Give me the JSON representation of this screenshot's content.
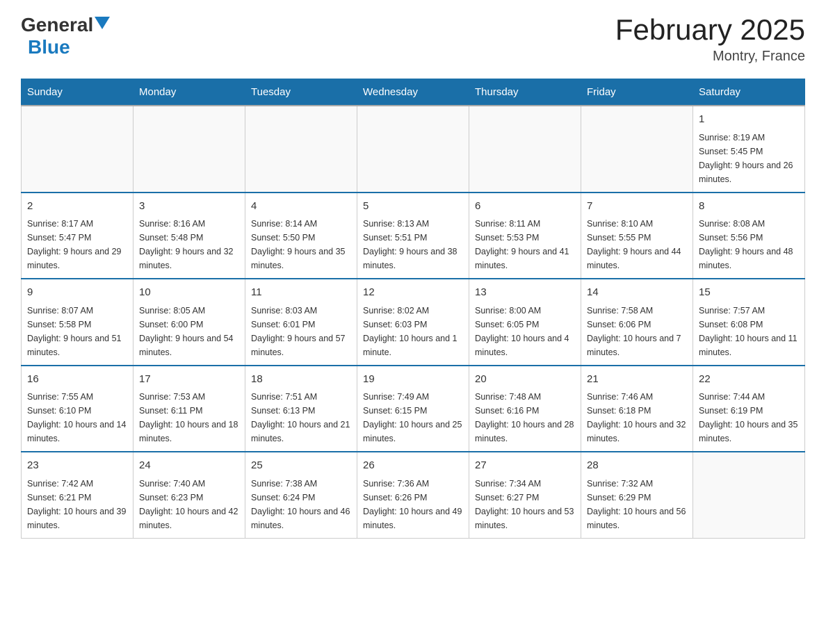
{
  "logo": {
    "general": "General",
    "blue": "Blue",
    "arrow": "▼"
  },
  "title": "February 2025",
  "location": "Montry, France",
  "days_of_week": [
    "Sunday",
    "Monday",
    "Tuesday",
    "Wednesday",
    "Thursday",
    "Friday",
    "Saturday"
  ],
  "weeks": [
    [
      {
        "day": "",
        "info": ""
      },
      {
        "day": "",
        "info": ""
      },
      {
        "day": "",
        "info": ""
      },
      {
        "day": "",
        "info": ""
      },
      {
        "day": "",
        "info": ""
      },
      {
        "day": "",
        "info": ""
      },
      {
        "day": "1",
        "info": "Sunrise: 8:19 AM\nSunset: 5:45 PM\nDaylight: 9 hours and 26 minutes."
      }
    ],
    [
      {
        "day": "2",
        "info": "Sunrise: 8:17 AM\nSunset: 5:47 PM\nDaylight: 9 hours and 29 minutes."
      },
      {
        "day": "3",
        "info": "Sunrise: 8:16 AM\nSunset: 5:48 PM\nDaylight: 9 hours and 32 minutes."
      },
      {
        "day": "4",
        "info": "Sunrise: 8:14 AM\nSunset: 5:50 PM\nDaylight: 9 hours and 35 minutes."
      },
      {
        "day": "5",
        "info": "Sunrise: 8:13 AM\nSunset: 5:51 PM\nDaylight: 9 hours and 38 minutes."
      },
      {
        "day": "6",
        "info": "Sunrise: 8:11 AM\nSunset: 5:53 PM\nDaylight: 9 hours and 41 minutes."
      },
      {
        "day": "7",
        "info": "Sunrise: 8:10 AM\nSunset: 5:55 PM\nDaylight: 9 hours and 44 minutes."
      },
      {
        "day": "8",
        "info": "Sunrise: 8:08 AM\nSunset: 5:56 PM\nDaylight: 9 hours and 48 minutes."
      }
    ],
    [
      {
        "day": "9",
        "info": "Sunrise: 8:07 AM\nSunset: 5:58 PM\nDaylight: 9 hours and 51 minutes."
      },
      {
        "day": "10",
        "info": "Sunrise: 8:05 AM\nSunset: 6:00 PM\nDaylight: 9 hours and 54 minutes."
      },
      {
        "day": "11",
        "info": "Sunrise: 8:03 AM\nSunset: 6:01 PM\nDaylight: 9 hours and 57 minutes."
      },
      {
        "day": "12",
        "info": "Sunrise: 8:02 AM\nSunset: 6:03 PM\nDaylight: 10 hours and 1 minute."
      },
      {
        "day": "13",
        "info": "Sunrise: 8:00 AM\nSunset: 6:05 PM\nDaylight: 10 hours and 4 minutes."
      },
      {
        "day": "14",
        "info": "Sunrise: 7:58 AM\nSunset: 6:06 PM\nDaylight: 10 hours and 7 minutes."
      },
      {
        "day": "15",
        "info": "Sunrise: 7:57 AM\nSunset: 6:08 PM\nDaylight: 10 hours and 11 minutes."
      }
    ],
    [
      {
        "day": "16",
        "info": "Sunrise: 7:55 AM\nSunset: 6:10 PM\nDaylight: 10 hours and 14 minutes."
      },
      {
        "day": "17",
        "info": "Sunrise: 7:53 AM\nSunset: 6:11 PM\nDaylight: 10 hours and 18 minutes."
      },
      {
        "day": "18",
        "info": "Sunrise: 7:51 AM\nSunset: 6:13 PM\nDaylight: 10 hours and 21 minutes."
      },
      {
        "day": "19",
        "info": "Sunrise: 7:49 AM\nSunset: 6:15 PM\nDaylight: 10 hours and 25 minutes."
      },
      {
        "day": "20",
        "info": "Sunrise: 7:48 AM\nSunset: 6:16 PM\nDaylight: 10 hours and 28 minutes."
      },
      {
        "day": "21",
        "info": "Sunrise: 7:46 AM\nSunset: 6:18 PM\nDaylight: 10 hours and 32 minutes."
      },
      {
        "day": "22",
        "info": "Sunrise: 7:44 AM\nSunset: 6:19 PM\nDaylight: 10 hours and 35 minutes."
      }
    ],
    [
      {
        "day": "23",
        "info": "Sunrise: 7:42 AM\nSunset: 6:21 PM\nDaylight: 10 hours and 39 minutes."
      },
      {
        "day": "24",
        "info": "Sunrise: 7:40 AM\nSunset: 6:23 PM\nDaylight: 10 hours and 42 minutes."
      },
      {
        "day": "25",
        "info": "Sunrise: 7:38 AM\nSunset: 6:24 PM\nDaylight: 10 hours and 46 minutes."
      },
      {
        "day": "26",
        "info": "Sunrise: 7:36 AM\nSunset: 6:26 PM\nDaylight: 10 hours and 49 minutes."
      },
      {
        "day": "27",
        "info": "Sunrise: 7:34 AM\nSunset: 6:27 PM\nDaylight: 10 hours and 53 minutes."
      },
      {
        "day": "28",
        "info": "Sunrise: 7:32 AM\nSunset: 6:29 PM\nDaylight: 10 hours and 56 minutes."
      },
      {
        "day": "",
        "info": ""
      }
    ]
  ]
}
